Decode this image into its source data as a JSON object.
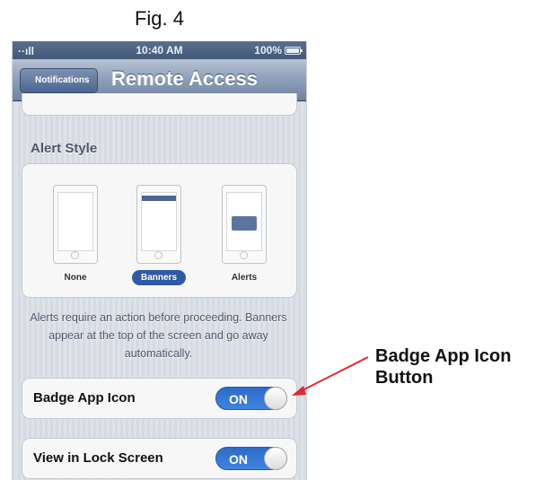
{
  "figure": {
    "title": "Fig. 4"
  },
  "status_bar": {
    "signal": "··ıll",
    "time": "10:40 AM",
    "battery": "100%"
  },
  "nav_bar": {
    "back_label": "Notifications",
    "title": "Remote Access"
  },
  "alert_style": {
    "section_title": "Alert Style",
    "options": [
      {
        "label": "None",
        "selected": false
      },
      {
        "label": "Banners",
        "selected": true
      },
      {
        "label": "Alerts",
        "selected": false
      }
    ],
    "description": "Alerts require an action before proceeding. Banners appear at the top of the screen and go away automatically."
  },
  "settings": [
    {
      "label": "Badge App Icon",
      "toggle": "ON"
    },
    {
      "label": "View in Lock Screen",
      "toggle": "ON"
    }
  ],
  "annotation": {
    "line1": "Badge App Icon",
    "line2": "Button",
    "color": "#e0282e"
  }
}
